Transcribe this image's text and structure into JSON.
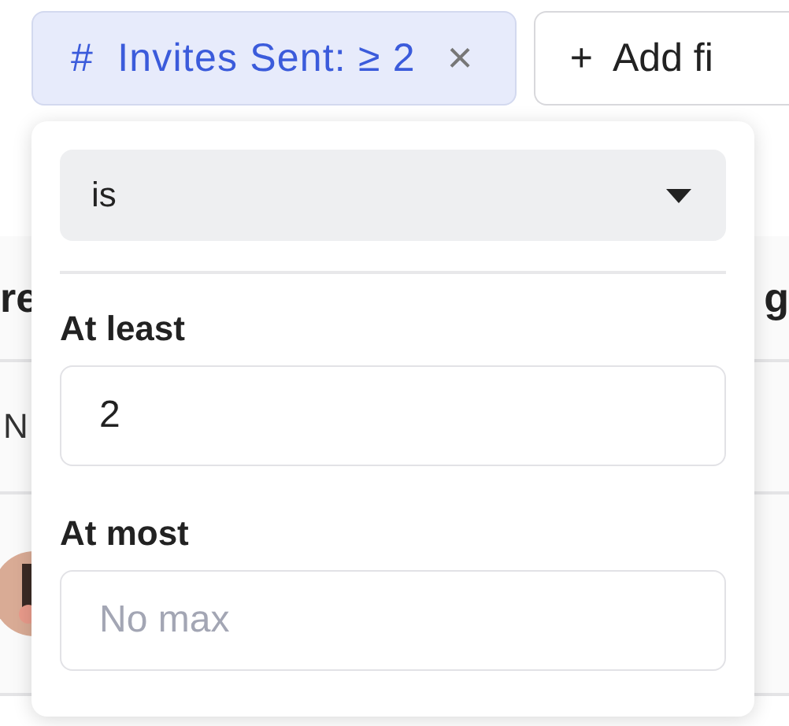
{
  "toolbar": {
    "filter_chip": {
      "icon": "#",
      "label": "Invites Sent: ≥ 2",
      "remove": "×"
    },
    "add_filter": {
      "icon": "+",
      "label": "Add fi"
    }
  },
  "table": {
    "columns": [
      "re",
      "g"
    ],
    "rows": [
      {
        "cell": "N"
      },
      {
        "kind": "picture"
      }
    ]
  },
  "popover": {
    "operator": {
      "value": "is"
    },
    "fields": [
      {
        "label": "At least",
        "value": "2"
      },
      {
        "label": "At most",
        "placeholder": "No max"
      }
    ]
  }
}
